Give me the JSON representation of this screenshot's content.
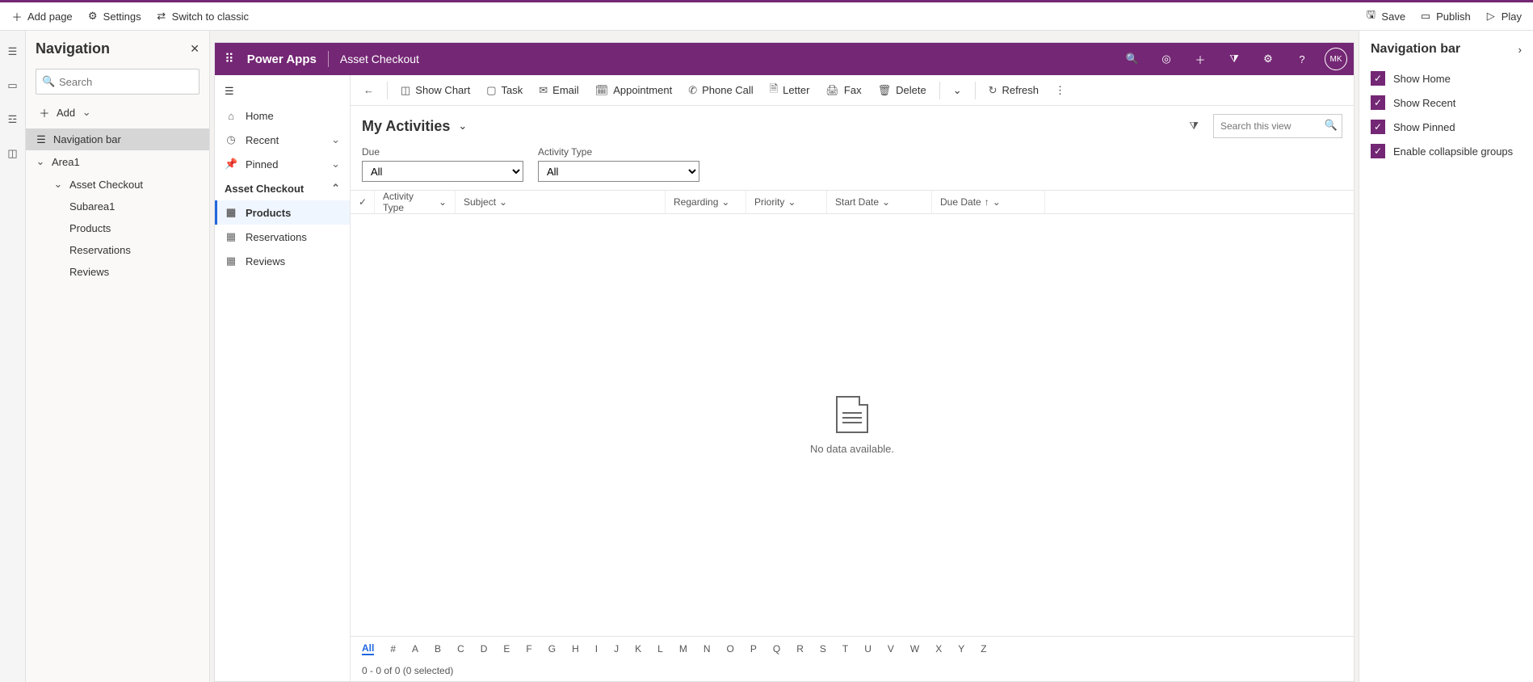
{
  "toolbar": {
    "left": {
      "add_page": "Add page",
      "settings": "Settings",
      "switch_classic": "Switch to classic"
    },
    "right": {
      "save": "Save",
      "publish": "Publish",
      "play": "Play"
    }
  },
  "nav_panel": {
    "title": "Navigation",
    "search_placeholder": "Search",
    "add_label": "Add",
    "tree": {
      "navigation_bar": "Navigation bar",
      "area1": "Area1",
      "asset_checkout": "Asset Checkout",
      "subarea1": "Subarea1",
      "products": "Products",
      "reservations": "Reservations",
      "reviews": "Reviews"
    }
  },
  "preview": {
    "brand": "Power Apps",
    "app_name": "Asset Checkout",
    "avatar": "MK",
    "side_nav": {
      "home": "Home",
      "recent": "Recent",
      "pinned": "Pinned",
      "group": "Asset Checkout",
      "products": "Products",
      "reservations": "Reservations",
      "reviews": "Reviews"
    },
    "commands": {
      "show_chart": "Show Chart",
      "task": "Task",
      "email": "Email",
      "appointment": "Appointment",
      "phone_call": "Phone Call",
      "letter": "Letter",
      "fax": "Fax",
      "delete": "Delete",
      "refresh": "Refresh"
    },
    "view": {
      "title": "My Activities",
      "search_placeholder": "Search this view",
      "filters": {
        "due_label": "Due",
        "due_value": "All",
        "type_label": "Activity Type",
        "type_value": "All"
      },
      "columns": {
        "activity_type": "Activity Type",
        "subject": "Subject",
        "regarding": "Regarding",
        "priority": "Priority",
        "start_date": "Start Date",
        "due_date": "Due Date"
      },
      "empty": "No data available.",
      "alpha": [
        "All",
        "#",
        "A",
        "B",
        "C",
        "D",
        "E",
        "F",
        "G",
        "H",
        "I",
        "J",
        "K",
        "L",
        "M",
        "N",
        "O",
        "P",
        "Q",
        "R",
        "S",
        "T",
        "U",
        "V",
        "W",
        "X",
        "Y",
        "Z"
      ],
      "status": "0 - 0 of 0 (0 selected)"
    }
  },
  "rpanel": {
    "title": "Navigation bar",
    "options": {
      "show_home": "Show Home",
      "show_recent": "Show Recent",
      "show_pinned": "Show Pinned",
      "collapsible": "Enable collapsible groups"
    }
  }
}
